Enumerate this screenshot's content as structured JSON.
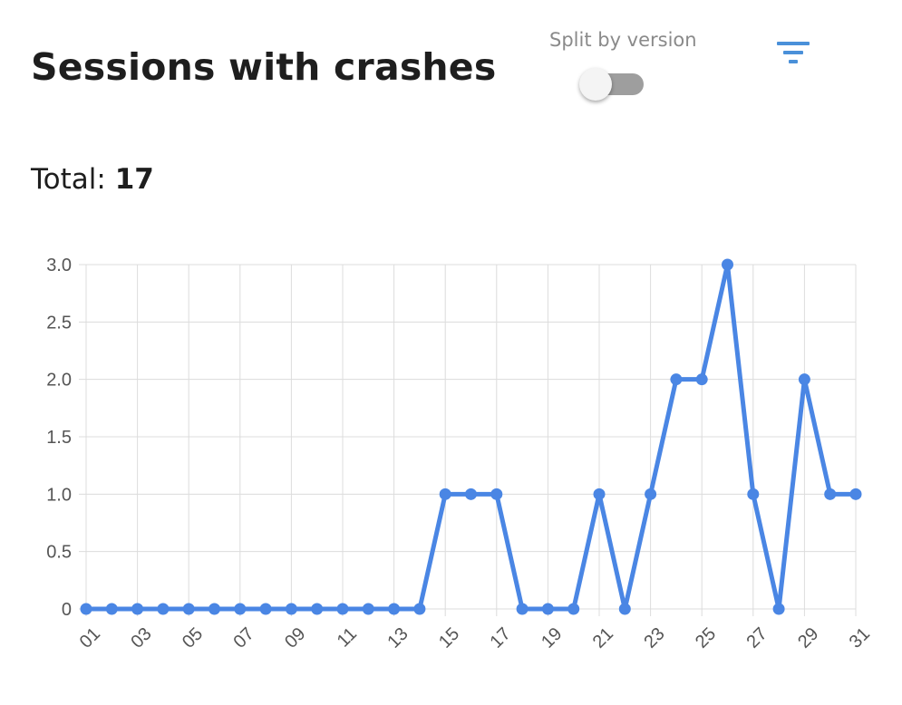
{
  "header": {
    "title": "Sessions with crashes",
    "split_label": "Split by version",
    "split_enabled": false
  },
  "total": {
    "label": "Total:",
    "value": "17"
  },
  "colors": {
    "line": "#4a86e4",
    "grid": "#dcdcdc",
    "tick_text": "#555555",
    "filter_icon": "#4a90d9"
  },
  "icons": {
    "filter": "filter-icon"
  },
  "chart_data": {
    "type": "line",
    "x": [
      "01",
      "02",
      "03",
      "04",
      "05",
      "06",
      "07",
      "08",
      "09",
      "10",
      "11",
      "12",
      "13",
      "14",
      "15",
      "16",
      "17",
      "18",
      "19",
      "20",
      "21",
      "22",
      "23",
      "24",
      "25",
      "26",
      "27",
      "28",
      "29",
      "30",
      "31"
    ],
    "x_tick_labels": [
      "01",
      "03",
      "05",
      "07",
      "09",
      "11",
      "13",
      "15",
      "17",
      "19",
      "21",
      "23",
      "25",
      "27",
      "29",
      "31"
    ],
    "y_tick_labels": [
      "0",
      "0.5",
      "1.0",
      "1.5",
      "2.0",
      "2.5",
      "3.0"
    ],
    "series": [
      {
        "values": [
          0,
          0,
          0,
          0,
          0,
          0,
          0,
          0,
          0,
          0,
          0,
          0,
          0,
          0,
          1,
          1,
          1,
          0,
          0,
          0,
          1,
          0,
          1,
          2,
          2,
          3,
          1,
          0,
          2,
          1,
          1
        ]
      }
    ],
    "title": "",
    "xlabel": "",
    "ylabel": "",
    "ylim": [
      0,
      3
    ],
    "grid": true,
    "legend": "none"
  }
}
